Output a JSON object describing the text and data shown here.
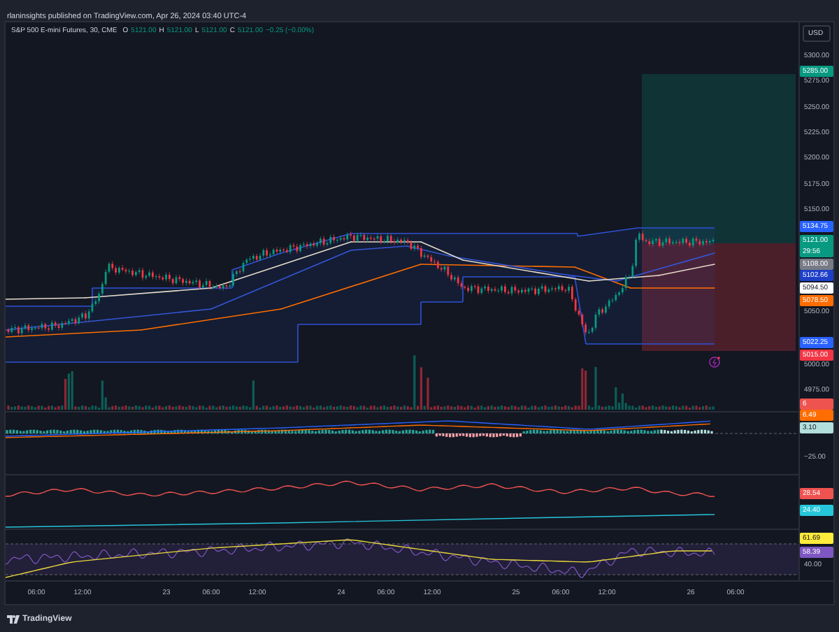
{
  "header": {
    "publisher_line": "rlaninsights published on TradingView.com, Apr 26, 2024 03:40 UTC-4"
  },
  "chart": {
    "legend": {
      "symbol": "S&P 500 E-mini Futures, 30, CME",
      "ohlc": [
        {
          "label": "O",
          "value": "5121.00"
        },
        {
          "label": "H",
          "value": "5121.00"
        },
        {
          "label": "L",
          "value": "5121.00"
        },
        {
          "label": "C",
          "value": "5121.00"
        }
      ],
      "change": "−0.25 (−0.00%)"
    },
    "currency_button": "USD",
    "axis_ticks": [
      "5300.00",
      "5275.00",
      "5250.00",
      "5225.00",
      "5200.00",
      "5175.00",
      "5150.00",
      "5050.00",
      "5000.00",
      "4975.00",
      "−25.00",
      "40.00"
    ],
    "price_badges": [
      {
        "value": "5285.00",
        "color": "#089981"
      },
      {
        "value": "5134.75",
        "color": "#2962ff"
      },
      {
        "value": "5121.00",
        "countdown": "29:56",
        "color": "#089981"
      },
      {
        "value": "5108.00",
        "color": "#787b86"
      },
      {
        "value": "5102.66",
        "color": "#1e3fc8"
      },
      {
        "value": "5094.50",
        "color": "#ffffff"
      },
      {
        "value": "5078.50",
        "color": "#ff6d00"
      },
      {
        "value": "5022.25",
        "color": "#2962ff"
      },
      {
        "value": "5015.00",
        "color": "#f23645"
      },
      {
        "value": "6",
        "color": "#ef5350"
      },
      {
        "value": "6.49",
        "color": "#ff6d00"
      },
      {
        "value": "3.10",
        "color": "#b2dfdb"
      },
      {
        "value": "28.54",
        "color": "#ef5350"
      },
      {
        "value": "24.40",
        "color": "#26c6da"
      },
      {
        "value": "61.69",
        "color": "#ffeb3b"
      },
      {
        "value": "58.39",
        "color": "#7e57c2"
      }
    ],
    "time_axis": [
      "06:00",
      "12:00",
      "23",
      "06:00",
      "12:00",
      "24",
      "06:00",
      "12:00",
      "25",
      "06:00",
      "12:00",
      "26",
      "06:00"
    ]
  },
  "footer": {
    "logo_text": "TradingView"
  }
}
